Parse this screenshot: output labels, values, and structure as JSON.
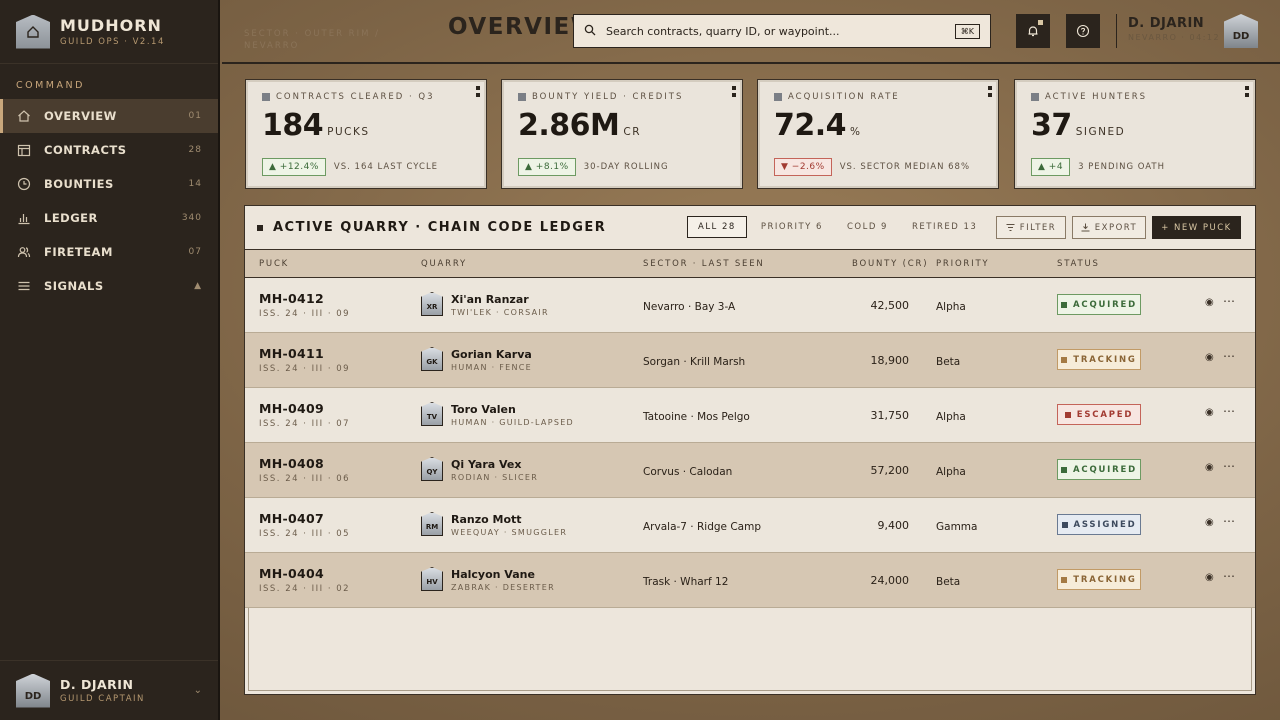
{
  "brand": {
    "name": "MUDHORN",
    "sub": "GUILD OPS · V2.14"
  },
  "sidebar": {
    "section": "COMMAND",
    "items": [
      {
        "label": "OVERVIEW",
        "count": "01",
        "icon": "home-icon",
        "active": true
      },
      {
        "label": "CONTRACTS",
        "count": "28",
        "icon": "calendar-icon"
      },
      {
        "label": "BOUNTIES",
        "count": "14",
        "icon": "clock-icon"
      },
      {
        "label": "LEDGER",
        "count": "340",
        "icon": "bar-chart-icon"
      },
      {
        "label": "FIRETEAM",
        "count": "07",
        "icon": "users-icon"
      },
      {
        "label": "SIGNALS",
        "count": "▲",
        "icon": "menu-icon"
      }
    ],
    "footer": {
      "initials": "DD",
      "name": "D. DJARIN",
      "role": "GUILD CAPTAIN"
    }
  },
  "header": {
    "breadcrumb": "SECTOR · OUTER RIM / NEVARRO",
    "title": "OVERVIEW",
    "search": {
      "placeholder": "Search contracts, quarry ID, or waypoint...",
      "shortcut": "⌘K"
    },
    "user": {
      "name": "D. DJARIN",
      "sub": "NEVARRO · 04:12",
      "initials": "DD"
    }
  },
  "kpis": [
    {
      "label": "CONTRACTS CLEARED · Q3",
      "value": "184",
      "unit": "PUCKS",
      "delta": "▲ +12.4%",
      "trend": "up",
      "note": "VS. 164 LAST CYCLE"
    },
    {
      "label": "BOUNTY YIELD · CREDITS",
      "value": "2.86M",
      "unit": "CR",
      "delta": "▲ +8.1%",
      "trend": "up",
      "note": "30-DAY ROLLING"
    },
    {
      "label": "ACQUISITION RATE",
      "value": "72.4",
      "unit": "%",
      "delta": "▼ −2.6%",
      "trend": "down",
      "note": "VS. SECTOR MEDIAN 68%"
    },
    {
      "label": "ACTIVE HUNTERS",
      "value": "37",
      "unit": "SIGNED",
      "delta": "▲ +4",
      "trend": "up",
      "note": "3 PENDING OATH"
    }
  ],
  "ledger": {
    "title": "ACTIVE QUARRY · CHAIN CODE LEDGER",
    "filters": [
      "ALL 28",
      "PRIORITY 6",
      "COLD 9",
      "RETIRED 13"
    ],
    "actions": {
      "filter": "FILTER",
      "export": "EXPORT",
      "new": "+ NEW PUCK"
    },
    "columns": [
      "PUCK",
      "QUARRY",
      "SECTOR · LAST SEEN",
      "BOUNTY (CR)",
      "PRIORITY",
      "STATUS"
    ],
    "rows": [
      {
        "id": "MH-0412",
        "iss": "ISS. 24 · III · 09",
        "initials": "XR",
        "name": "Xi'an Ranzar",
        "sub": "TWI'LEK · CORSAIR",
        "sector": "Nevarro · Bay 3-A",
        "bounty": "42,500",
        "priority": "Alpha",
        "status": "ACQUIRED",
        "kind": "acq"
      },
      {
        "id": "MH-0411",
        "iss": "ISS. 24 · III · 09",
        "initials": "GK",
        "name": "Gorian Karva",
        "sub": "HUMAN · FENCE",
        "sector": "Sorgan · Krill Marsh",
        "bounty": "18,900",
        "priority": "Beta",
        "status": "TRACKING",
        "kind": "trk"
      },
      {
        "id": "MH-0409",
        "iss": "ISS. 24 · III · 07",
        "initials": "TV",
        "name": "Toro Valen",
        "sub": "HUMAN · GUILD-LAPSED",
        "sector": "Tatooine · Mos Pelgo",
        "bounty": "31,750",
        "priority": "Alpha",
        "status": "ESCAPED",
        "kind": "esc"
      },
      {
        "id": "MH-0408",
        "iss": "ISS. 24 · III · 06",
        "initials": "QY",
        "name": "Qi Yara Vex",
        "sub": "RODIAN · SLICER",
        "sector": "Corvus · Calodan",
        "bounty": "57,200",
        "priority": "Alpha",
        "status": "ACQUIRED",
        "kind": "acq"
      },
      {
        "id": "MH-0407",
        "iss": "ISS. 24 · III · 05",
        "initials": "RM",
        "name": "Ranzo Mott",
        "sub": "WEEQUAY · SMUGGLER",
        "sector": "Arvala-7 · Ridge Camp",
        "bounty": "9,400",
        "priority": "Gamma",
        "status": "ASSIGNED",
        "kind": "asg"
      },
      {
        "id": "MH-0404",
        "iss": "ISS. 24 · III · 02",
        "initials": "HV",
        "name": "Halcyon Vane",
        "sub": "ZABRAK · DESERTER",
        "sector": "Trask · Wharf 12",
        "bounty": "24,000",
        "priority": "Beta",
        "status": "TRACKING",
        "kind": "trk"
      }
    ]
  }
}
